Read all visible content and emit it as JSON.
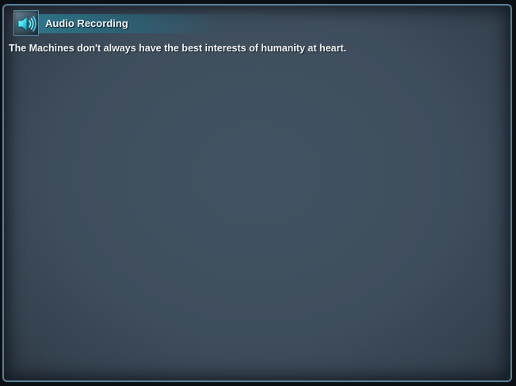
{
  "window": {
    "title": "Audio Recording",
    "icon": "speaker-icon"
  },
  "content": {
    "message": "The Machines don't always have the best interests of humanity at heart."
  },
  "colors": {
    "panel_bg": "#3f4e5d",
    "border": "#5b7f93",
    "header_accent": "#2e788c",
    "text": "#f2f5f6",
    "icon_glow": "#3fe0f0"
  }
}
